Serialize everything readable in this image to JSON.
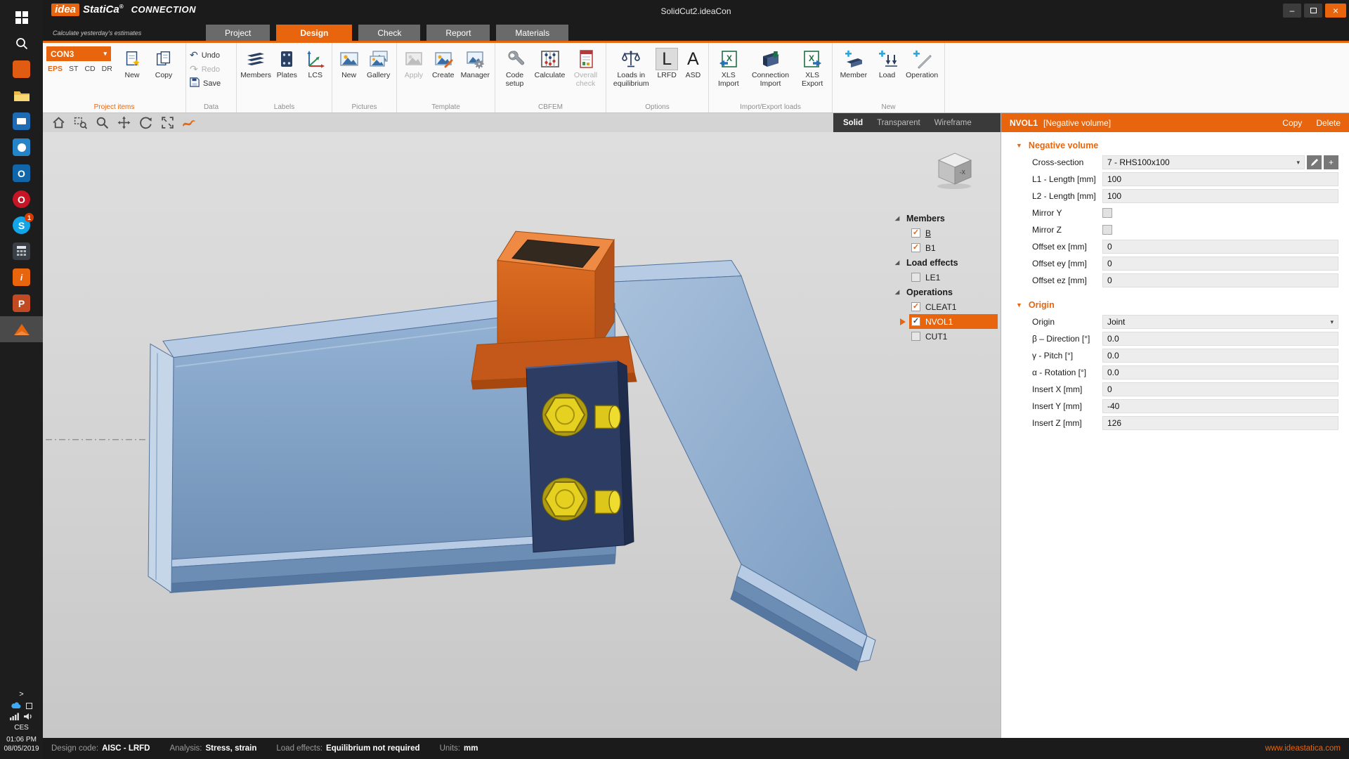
{
  "accent": "#e8650d",
  "icons": {
    "check": "✓",
    "dropdown": "▾",
    "section_arrow": "▼",
    "expander": "◢",
    "undo_arrow": "↶",
    "redo_arrow": "↷",
    "chevron": ">",
    "plus": "+",
    "minimize": "–",
    "close": "×"
  },
  "titlebar": {
    "brand_idea": "idea",
    "brand_statica": "StatiCa",
    "brand_reg": "®",
    "brand_product": "CONNECTION",
    "tagline": "Calculate yesterday's estimates",
    "title": "SolidCut2.ideaCon"
  },
  "taskbar": {
    "language": "CES",
    "time": "01:06 PM",
    "date": "08/05/2019",
    "skype_badge": "1",
    "outlook_letter": "O",
    "opera_letter": "O",
    "skype_letter": "S",
    "powerpoint_letter": "P"
  },
  "tabs": [
    "Project",
    "Design",
    "Check",
    "Report",
    "Materials"
  ],
  "ribbon": {
    "project_items": {
      "selector": "CON3",
      "eps": "EPS",
      "st": "ST",
      "cd": "CD",
      "dr": "DR",
      "new": "New",
      "copy": "Copy",
      "group": "Project items"
    },
    "data": {
      "undo": "Undo",
      "redo": "Redo",
      "save": "Save",
      "group": "Data"
    },
    "labels": {
      "members": "Members",
      "plates": "Plates",
      "lcs": "LCS",
      "group": "Labels"
    },
    "pictures": {
      "new": "New",
      "gallery": "Gallery",
      "group": "Pictures"
    },
    "template": {
      "apply": "Apply",
      "create": "Create",
      "manager": "Manager",
      "group": "Template"
    },
    "cbfem": {
      "code_setup": "Code setup",
      "calculate": "Calculate",
      "overall_check": "Overall check",
      "group": "CBFEM"
    },
    "options": {
      "loads": "Loads in equilibrium",
      "lrfd_letter": "L",
      "lrfd": "LRFD",
      "asd_letter": "A",
      "asd": "ASD",
      "group": "Options"
    },
    "import_export": {
      "xls_import": "XLS Import",
      "conn_import": "Connection Import",
      "xls_export": "XLS Export",
      "group": "Import/Export loads"
    },
    "new": {
      "member": "Member",
      "load": "Load",
      "operation": "Operation",
      "group": "New"
    }
  },
  "viewport": {
    "modes": {
      "solid": "Solid",
      "transparent": "Transparent",
      "wireframe": "Wireframe"
    }
  },
  "tree": {
    "members": {
      "title": "Members",
      "items": [
        {
          "label": "B",
          "checked": true
        },
        {
          "label": "B1",
          "checked": true
        }
      ]
    },
    "load_effects": {
      "title": "Load effects",
      "items": [
        {
          "label": "LE1",
          "checked": false
        }
      ]
    },
    "operations": {
      "title": "Operations",
      "items": [
        {
          "label": "CLEAT1",
          "checked": true
        },
        {
          "label": "NVOL1",
          "checked": true,
          "selected": true
        },
        {
          "label": "CUT1",
          "checked": false
        }
      ]
    }
  },
  "panel": {
    "title": "NVOL1",
    "subtitle": "[Negative volume]",
    "copy": "Copy",
    "delete": "Delete",
    "section1": {
      "title": "Negative volume",
      "cross_section": {
        "label": "Cross-section",
        "value": "7 - RHS100x100"
      },
      "l1": {
        "label": "L1 - Length [mm]",
        "value": "100"
      },
      "l2": {
        "label": "L2 - Length [mm]",
        "value": "100"
      },
      "mirror_y": {
        "label": "Mirror Y",
        "checked": false
      },
      "mirror_z": {
        "label": "Mirror Z",
        "checked": false
      },
      "offset_ex": {
        "label": "Offset ex [mm]",
        "value": "0"
      },
      "offset_ey": {
        "label": "Offset ey [mm]",
        "value": "0"
      },
      "offset_ez": {
        "label": "Offset ez [mm]",
        "value": "0"
      }
    },
    "section2": {
      "title": "Origin",
      "origin": {
        "label": "Origin",
        "value": "Joint"
      },
      "beta": {
        "label": "β – Direction [°]",
        "value": "0.0"
      },
      "gamma": {
        "label": "γ - Pitch [°]",
        "value": "0.0"
      },
      "alpha": {
        "label": "α - Rotation [°]",
        "value": "0.0"
      },
      "insert_x": {
        "label": "Insert X [mm]",
        "value": "0"
      },
      "insert_y": {
        "label": "Insert Y [mm]",
        "value": "-40"
      },
      "insert_z": {
        "label": "Insert Z [mm]",
        "value": "126"
      }
    }
  },
  "statusbar": {
    "design_code_label": "Design code:",
    "design_code": "AISC - LRFD",
    "analysis_label": "Analysis:",
    "analysis": "Stress, strain",
    "load_effects_label": "Load effects:",
    "load_effects": "Equilibrium not required",
    "units_label": "Units:",
    "units": "mm",
    "website": "www.ideastatica.com"
  }
}
